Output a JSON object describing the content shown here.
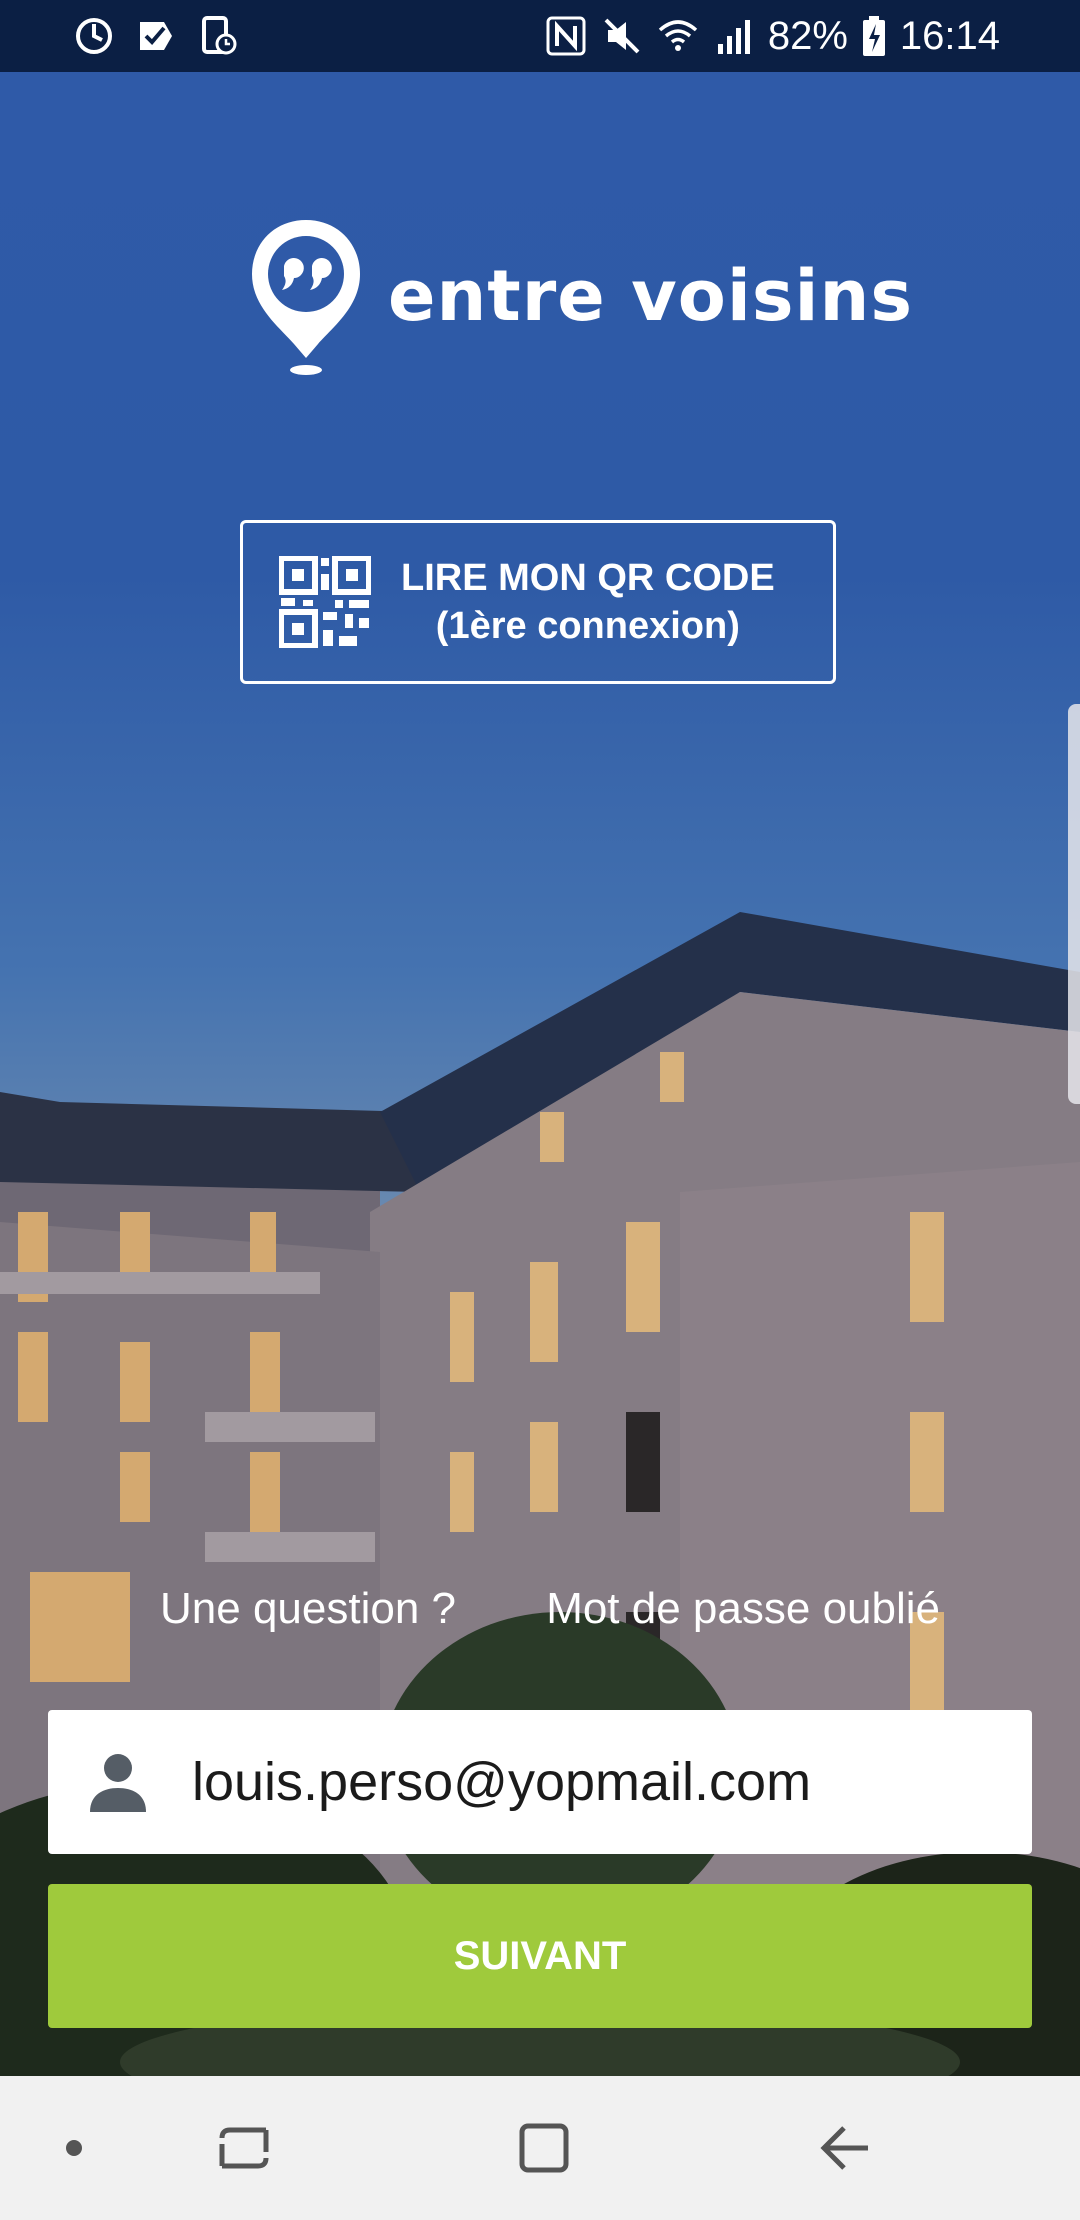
{
  "status_bar": {
    "battery": "82%",
    "time": "16:14"
  },
  "app": {
    "logo_text": "entre voisins"
  },
  "qr_button": {
    "line1": "LIRE MON QR CODE",
    "line2": "(1ère connexion)"
  },
  "links": {
    "question": "Une question ?",
    "forgot_password": "Mot de passe oublié"
  },
  "email_field": {
    "value": "louis.perso@yopmail.com"
  },
  "next_button": {
    "label": "SUIVANT"
  },
  "colors": {
    "accent_green": "#9fca3c",
    "sky_blue": "#2f5aa8",
    "status_bar": "#0b1f44"
  },
  "nav_bar": {
    "items": [
      "nav-dot-icon",
      "recents-icon",
      "home-icon",
      "back-icon"
    ]
  }
}
